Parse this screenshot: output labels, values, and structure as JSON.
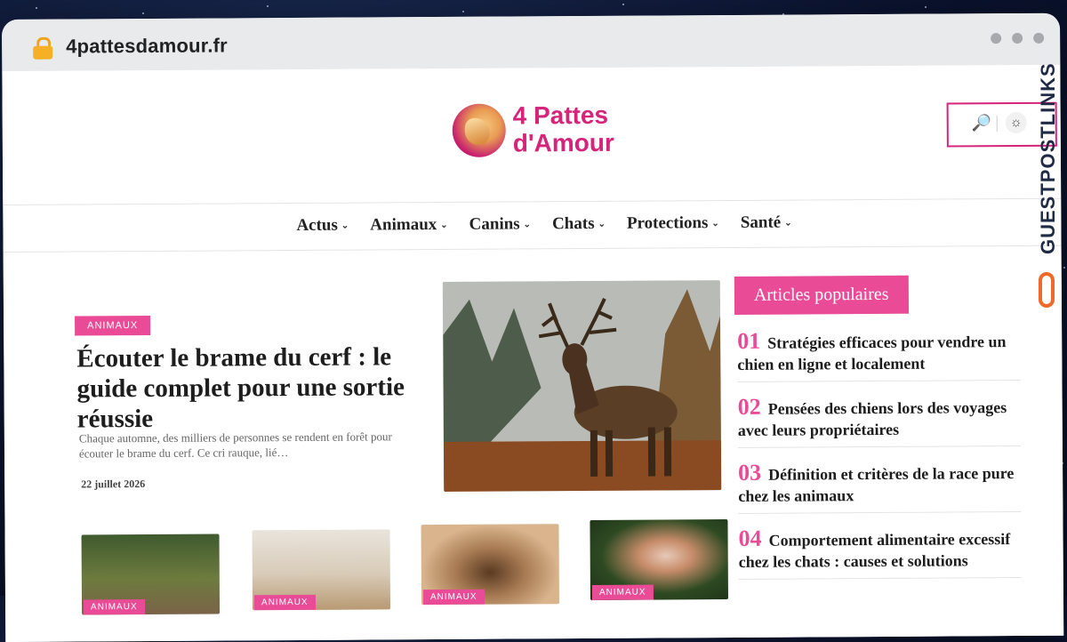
{
  "browser": {
    "url": "4pattesdamour.fr"
  },
  "watermark": "GUESTPOSTLINKS",
  "site": {
    "logo_text": "4 Pattes\nd'Amour",
    "brand_color": "#d6247a",
    "accent_color": "#e94b97"
  },
  "header_tools": {
    "search_icon": "search-icon",
    "theme_icon": "sun-icon",
    "search_glyph": "🔎",
    "theme_glyph": "☼",
    "separator": "|"
  },
  "nav": {
    "chevron": "⌄",
    "items": [
      {
        "label": "Actus"
      },
      {
        "label": "Animaux"
      },
      {
        "label": "Canins"
      },
      {
        "label": "Chats"
      },
      {
        "label": "Protections"
      },
      {
        "label": "Santé"
      }
    ]
  },
  "hero": {
    "category": "ANIMAUX",
    "title": "Écouter le brame du cerf : le guide complet pour une sortie réussie",
    "excerpt": "Chaque automne, des milliers de personnes se rendent en forêt pour écouter le brame du cerf. Ce cri rauque, lié…",
    "date": "22 juillet 2026"
  },
  "popular": {
    "heading": "Articles populaires",
    "items": [
      {
        "num": "01",
        "title": "Stratégies efficaces pour vendre un chien en ligne et localement"
      },
      {
        "num": "02",
        "title": "Pensées des chiens lors des voyages avec leurs propriétaires"
      },
      {
        "num": "03",
        "title": "Définition et critères de la race pure chez les animaux"
      },
      {
        "num": "04",
        "title": "Comportement alimentaire excessif chez les chats : causes et solutions"
      }
    ]
  },
  "cards": [
    {
      "category": "ANIMAUX"
    },
    {
      "category": "ANIMAUX"
    },
    {
      "category": "ANIMAUX"
    },
    {
      "category": "ANIMAUX"
    }
  ]
}
